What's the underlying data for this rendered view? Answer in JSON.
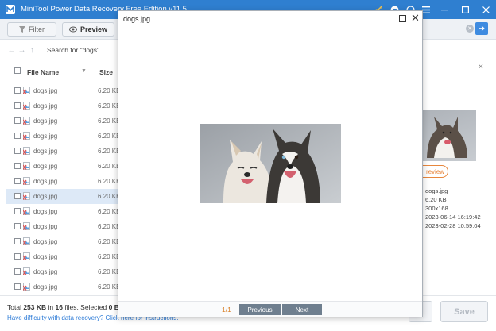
{
  "app": {
    "title": "MiniTool Power Data Recovery Free Edition v11.5"
  },
  "toolbar": {
    "filter_label": "Filter",
    "preview_label": "Preview"
  },
  "nav": {
    "search_label": "Search for \"dogs\""
  },
  "list": {
    "header_name": "File Name",
    "header_size": "Size",
    "rows": [
      {
        "name": "dogs.jpg",
        "size": "6.20 KB"
      },
      {
        "name": "dogs.jpg",
        "size": "6.20 KB"
      },
      {
        "name": "dogs.jpg",
        "size": "6.20 KB"
      },
      {
        "name": "dogs.jpg",
        "size": "6.20 KB"
      },
      {
        "name": "dogs.jpg",
        "size": "6.20 KB"
      },
      {
        "name": "dogs.jpg",
        "size": "6.20 KB"
      },
      {
        "name": "dogs.jpg",
        "size": "6.20 KB"
      },
      {
        "name": "dogs.jpg",
        "size": "6.20 KB"
      },
      {
        "name": "dogs.jpg",
        "size": "6.20 KB"
      },
      {
        "name": "dogs.jpg",
        "size": "6.20 KB"
      },
      {
        "name": "dogs.jpg",
        "size": "6.20 KB"
      },
      {
        "name": "dogs.jpg",
        "size": "6.20 KB"
      },
      {
        "name": "dogs.jpg",
        "size": "6.20 KB"
      },
      {
        "name": "dogs.jpg",
        "size": "6.20 KB"
      }
    ],
    "selected_row": 7
  },
  "details": {
    "preview_label": "review",
    "name": "dogs.jpg",
    "size": "6.20 KB",
    "dimensions": "300x168",
    "created": "2023-06-14 16:19:42",
    "modified": "2023-02-28 10:59:04"
  },
  "status": {
    "total_prefix": "Total ",
    "total_size": "253 KB",
    "total_mid": " in ",
    "file_count": "16",
    "total_suffix": " files.  Selected ",
    "selected_size": "0 Bytes",
    "help_link": "Have difficulty with data recovery? Click here for instructions.",
    "save_label": "Save"
  },
  "dialog": {
    "title": "dogs.jpg",
    "page_count": "1/1",
    "previous_label": "Previous",
    "next_label": "Next"
  },
  "colors": {
    "titlebar": "#2f7fd0",
    "accent_orange": "#e8873d",
    "link_blue": "#2a79d6",
    "dialog_button": "#6f7f8f"
  }
}
